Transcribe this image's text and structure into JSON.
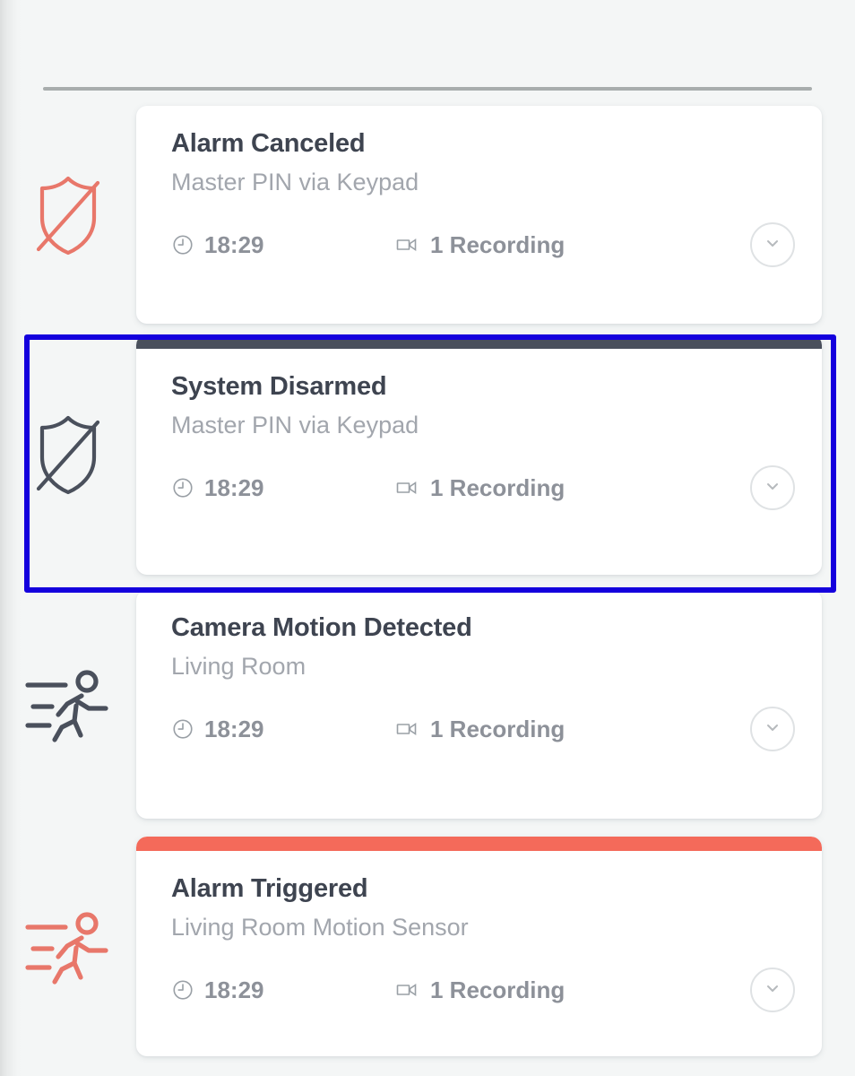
{
  "theme": {
    "page_bg": "#f4f6f6",
    "card_bg": "#ffffff",
    "title_color": "#3e4450",
    "subtitle_color": "#a2a6ad",
    "meta_color": "#8d9199",
    "alert_red": "#f46a5a",
    "dark_bar": "#4a505c",
    "selection_blue": "#1400dd"
  },
  "events": [
    {
      "title": "Alarm Canceled",
      "subtitle": "Master PIN via Keypad",
      "time": "18:29",
      "recordings": "1 Recording",
      "icon": "shield-off-icon",
      "icon_color": "#e8776a",
      "topbar_color": null,
      "selected": false
    },
    {
      "title": "System Disarmed",
      "subtitle": "Master PIN via Keypad",
      "time": "18:29",
      "recordings": "1 Recording",
      "icon": "shield-off-icon",
      "icon_color": "#4a505c",
      "topbar_color": "#4a505c",
      "selected": true
    },
    {
      "title": "Camera Motion Detected",
      "subtitle": "Living Room",
      "time": "18:29",
      "recordings": "1 Recording",
      "icon": "running-person-motion-icon",
      "icon_color": "#4a505c",
      "topbar_color": null,
      "selected": false
    },
    {
      "title": "Alarm Triggered",
      "subtitle": "Living Room Motion Sensor",
      "time": "18:29",
      "recordings": "1 Recording",
      "icon": "running-person-motion-icon",
      "icon_color": "#e8776a",
      "topbar_color": "#f46a5a",
      "selected": false
    }
  ],
  "icons": {
    "clock": "clock-icon",
    "camera": "video-camera-icon",
    "expand": "chevron-down-icon"
  }
}
